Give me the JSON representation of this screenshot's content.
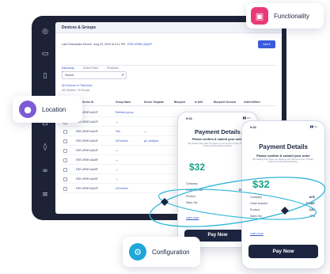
{
  "dashboard": {
    "title": "Devices & Groups",
    "onboard_label": "Last Onboarded Device : Aug 23, 2023 at 3:11 PM :",
    "onboard_device": "ESR-URNR-AAA2F",
    "add_button": "Add ▾",
    "tabs": [
      "Discovery",
      "Event Feed",
      "Provision"
    ],
    "search_placeholder": "Search",
    "breadcrumb": "All Devices in \"Directory\"",
    "breadcrumb_sub": "407 Devices · 93 Groups",
    "columns": [
      "Device ID",
      "Group Name",
      "Device Template",
      "Blueprint",
      "In Drift",
      "Blueprint Checked",
      "Online/Offline"
    ],
    "rows": [
      {
        "id": "ESR-URNR-AAA2F",
        "group": "Retention group"
      },
      {
        "id": "ESR-URNR-AAA2F",
        "group": "—"
      },
      {
        "id": "ESR-URNR-AAA4F",
        "group": "Test",
        "template": "—"
      },
      {
        "id": "ESR-URNR-AAA4F",
        "group": "All Devices",
        "template": "gir_configure"
      },
      {
        "id": "ESR-URNR-AAA4F",
        "group": "—"
      },
      {
        "id": "ESR-URNR-AAA6F",
        "group": "—"
      },
      {
        "id": "ESR-URNR-AAA5F",
        "group": "—"
      },
      {
        "id": "ESR-URNR-AAA5F",
        "group": "—"
      },
      {
        "id": "ESR-URNR-AAA2F",
        "group": "All Devices"
      }
    ]
  },
  "phone_back": {
    "status_time": "9:41",
    "title": "Payment Details",
    "subtitle": "Please confirm & submit your order",
    "note": "By clicking Pay Now you agree to our Terms of Use, Privacy Policy and the Refund Policy.",
    "amount": "$32",
    "fields": [
      {
        "label": "Company",
        "value": "ACE"
      },
      {
        "label": "Order Number",
        "value": "234567"
      },
      {
        "label": "Product",
        "value": "CAP"
      },
      {
        "label": "Sales Tax",
        "value": "17%"
      }
    ],
    "learn_more": "Learn more",
    "pay_button": "Pay Now"
  },
  "phone_front": {
    "status_time": "9:41",
    "title": "Payment Details",
    "subtitle": "Please confirm & submit your order",
    "note": "By clicking Pay Now you agree to our Terms of Use, Privacy Policy and the Refund Policy.",
    "amount": "$32",
    "fields": [
      {
        "label": "Company",
        "value": "ACE"
      },
      {
        "label": "Order Number",
        "value": "234567"
      },
      {
        "label": "Product",
        "value": "CAP"
      },
      {
        "label": "Sales Tax",
        "value": "17%"
      }
    ],
    "learn_more": "Learn more",
    "pay_button": "Pay Now"
  },
  "chips": {
    "functionality": "Functionality",
    "location": "Location",
    "configuration": "Configuration"
  },
  "colors": {
    "functionality": "#e93a78",
    "location": "#7b5bd6",
    "configuration": "#1fa7d8",
    "orbit": "#2fb6d9",
    "tablet": "#1d2236"
  }
}
